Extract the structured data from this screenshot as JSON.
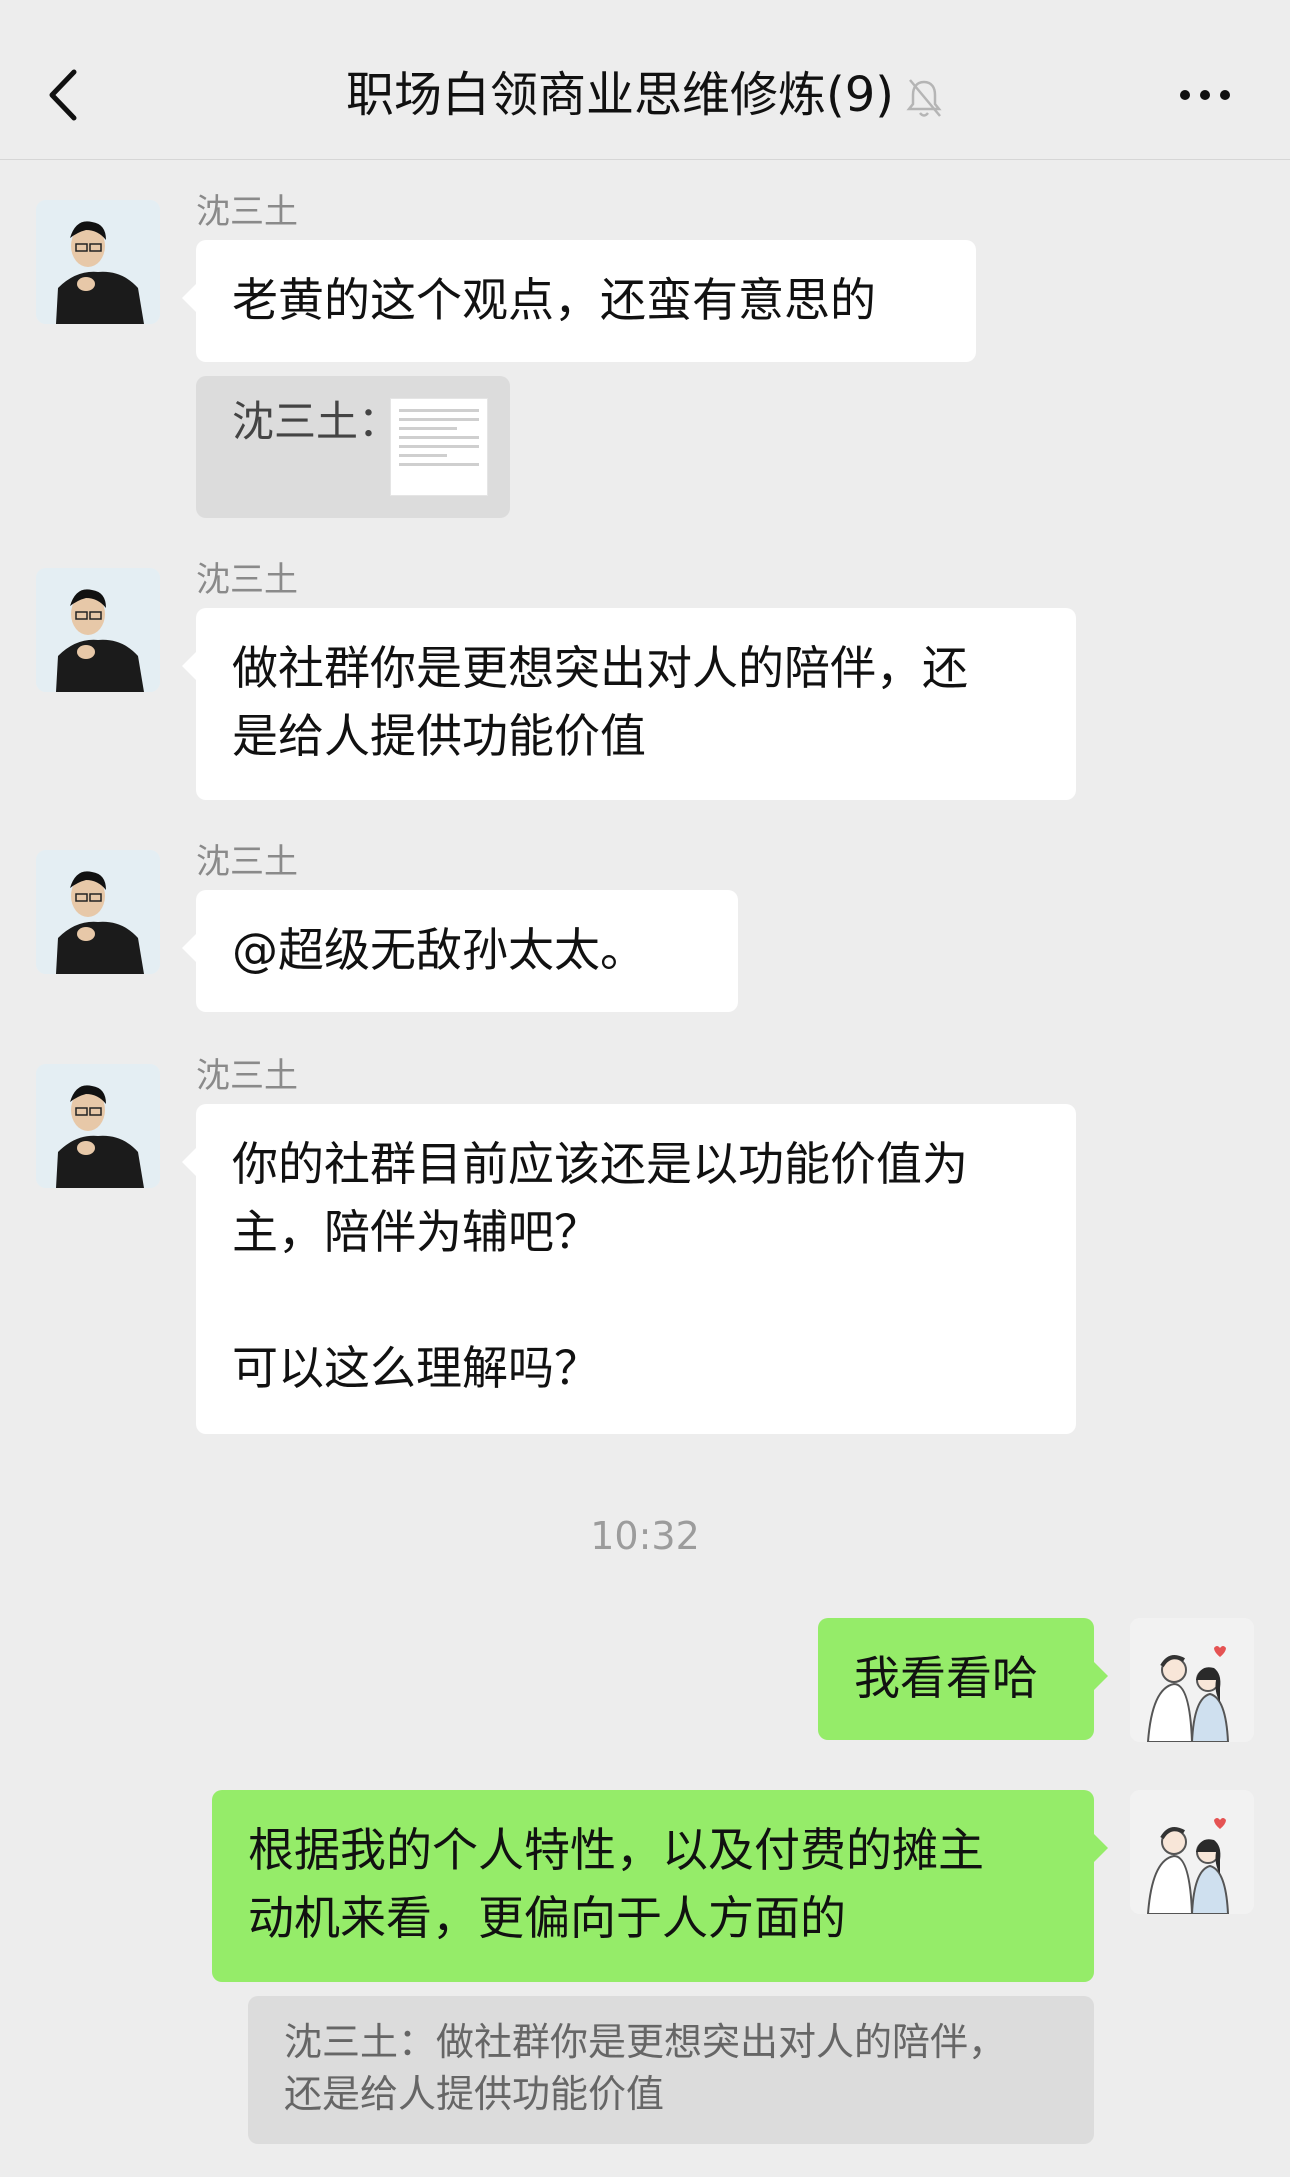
{
  "header": {
    "title": "职场白领商业思维修炼(9)"
  },
  "messages": [
    {
      "sender": "沈三土",
      "text": "老黄的这个观点，还蛮有意思的"
    },
    {
      "quote_label": "沈三土："
    },
    {
      "sender": "沈三土",
      "line1": "做社群你是更想突出对人的陪伴，还",
      "line2": "是给人提供功能价值"
    },
    {
      "sender": "沈三土",
      "text": "@超级无敌孙太太。"
    },
    {
      "sender": "沈三土",
      "line1": "你的社群目前应该还是以功能价值为",
      "line2": "主，陪伴为辅吧？",
      "line3": "可以这么理解吗？"
    }
  ],
  "timestamp": "10:32",
  "my_messages": [
    {
      "text": "我看看哈"
    },
    {
      "line1": "根据我的个人特性，以及付费的摊主",
      "line2": "动机来看，更偏向于人方面的"
    }
  ],
  "quote": {
    "line1": "沈三土：做社群你是更想突出对人的陪伴，",
    "line2": "还是给人提供功能价值"
  },
  "colors": {
    "background": "#ededed",
    "my_bubble": "#95ec69",
    "other_bubble": "#ffffff"
  }
}
